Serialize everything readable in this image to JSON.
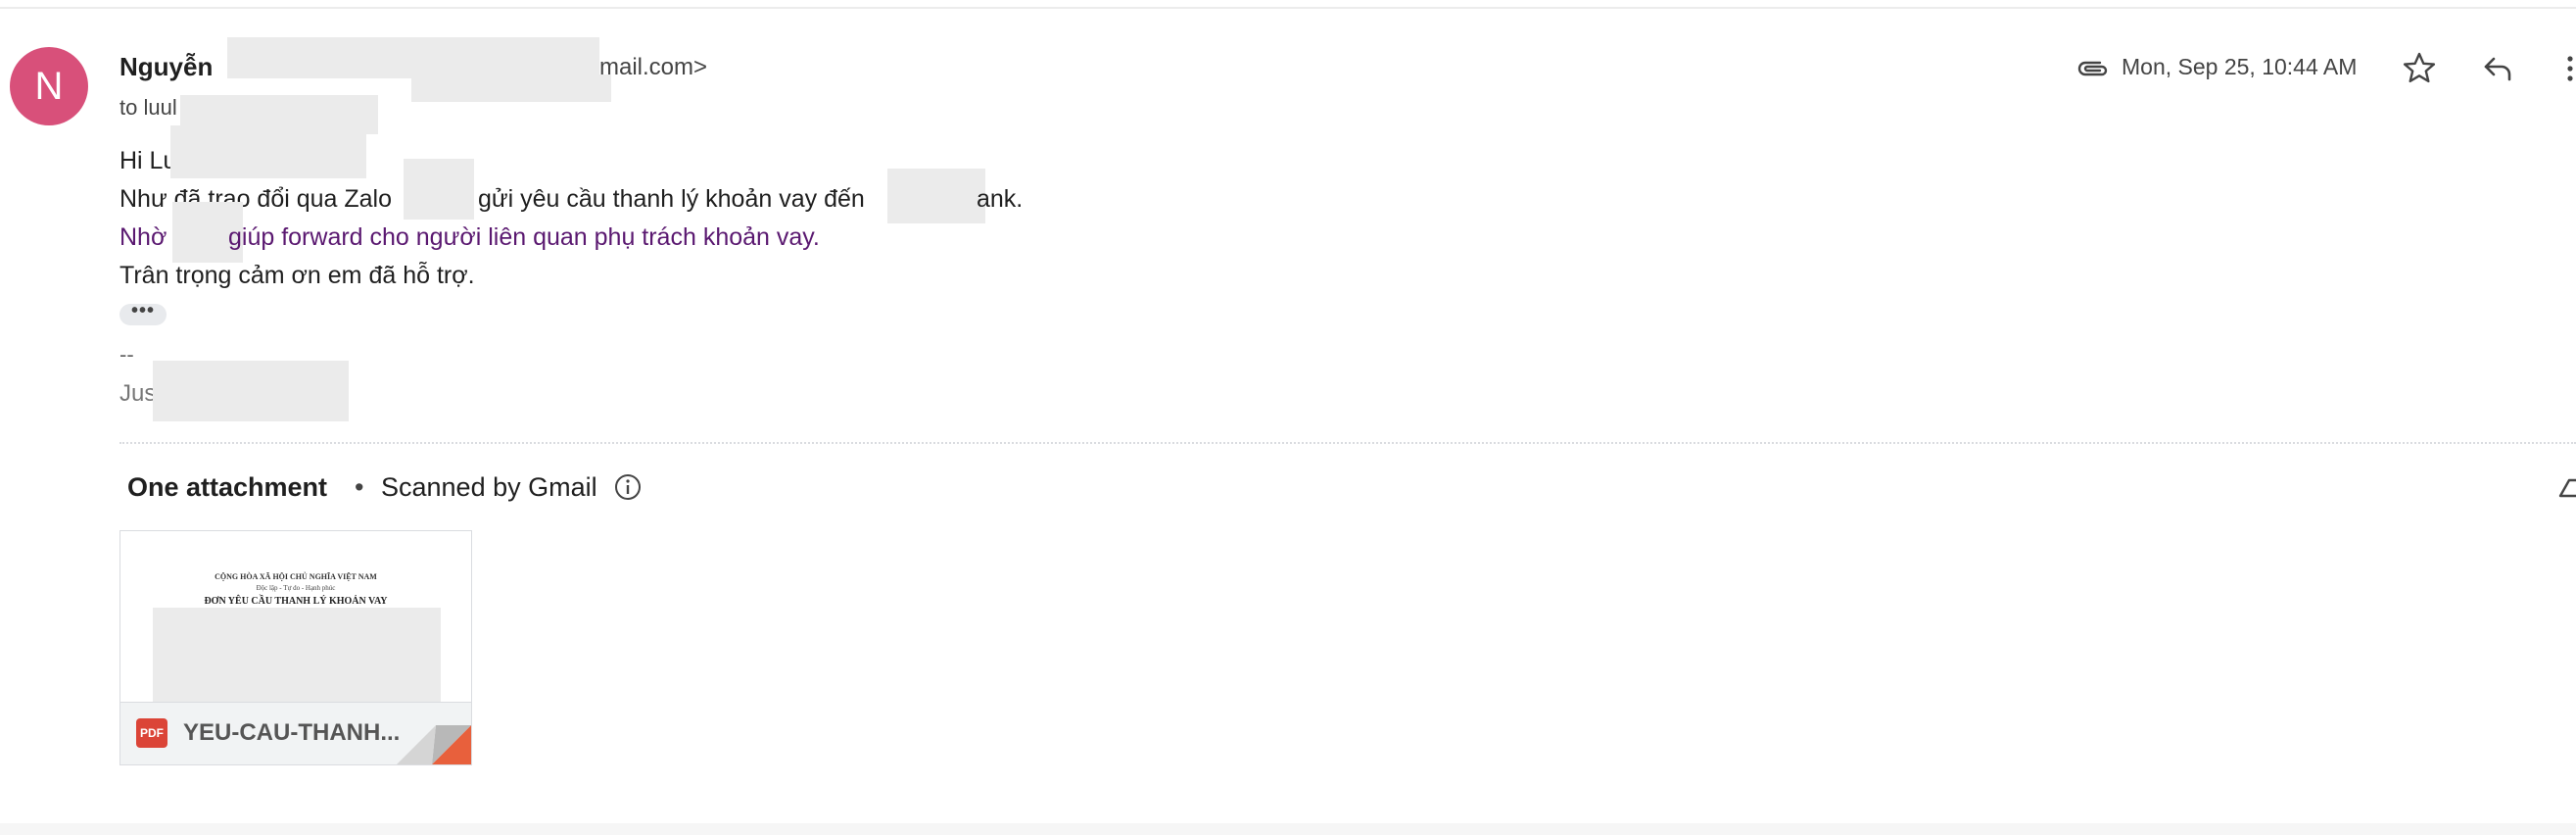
{
  "header": {
    "avatar_letter": "N",
    "sender_name": "Nguyễn",
    "sender_email_tail": "mail.com>",
    "to_label": "to luul",
    "date": "Mon, Sep 25, 10:44 AM",
    "icons": [
      "paperclip-icon",
      "star-icon",
      "reply-icon",
      "more-vert-icon"
    ]
  },
  "body": {
    "greeting": "Hi Lu",
    "line1_a": "Như đã trao đổi qua Zalo",
    "line1_b": "gửi yêu cầu thanh lý khoản vay đến",
    "line1_c": "ank.",
    "line2_a": "Nhờ",
    "line2_b": "giúp forward cho người liên quan phụ trách khoản vay.",
    "line3": "Trân trọng cảm ơn em đã hỗ trợ.",
    "show_trimmed": "•••",
    "signature_dash": "--",
    "signature_name": "Jus"
  },
  "attachments": {
    "title": "One attachment",
    "separator": "•",
    "scanned": "Scanned by Gmail",
    "file": {
      "type_badge": "PDF",
      "name": "YEU-CAU-THANH...",
      "preview_line1": "CỘNG HÒA XÃ HỘI CHỦ NGHĨA VIỆT NAM",
      "preview_line2": "Độc lập - Tự do - Hạnh phúc",
      "preview_title": "ĐƠN YÊU CẦU THANH LÝ KHOẢN VAY"
    }
  },
  "colors": {
    "avatar": "#d8507a",
    "link_purple": "#5a1870",
    "pdf_red": "#db4437",
    "fold_orange": "#e8603c"
  }
}
